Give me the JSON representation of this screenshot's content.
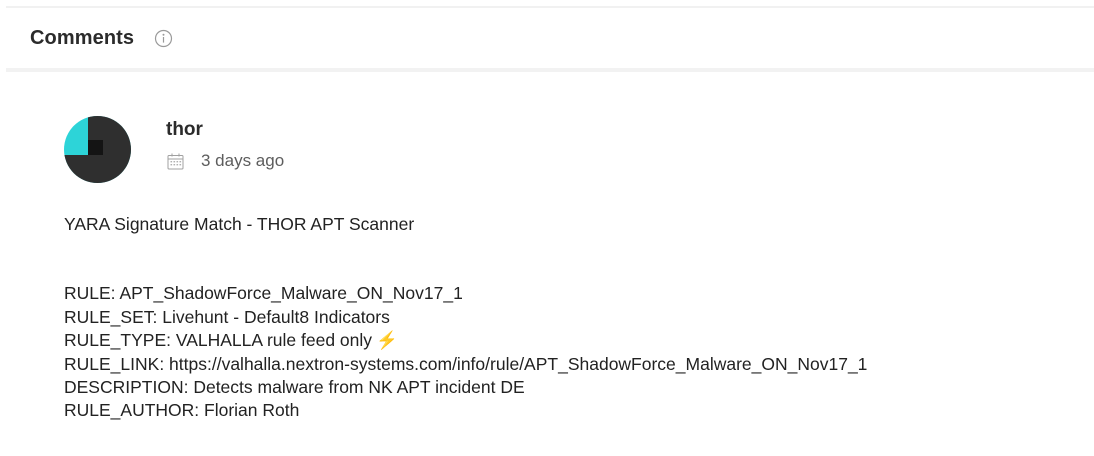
{
  "header": {
    "title": "Comments",
    "info_icon": "info-circle-icon"
  },
  "comment": {
    "author": "thor",
    "date": "3 days ago",
    "avatar_colors": {
      "accent": "#2dd4d8",
      "dark": "#2f2f2f"
    },
    "heading": "YARA Signature Match - THOR APT Scanner",
    "lines": [
      {
        "text": "RULE: APT_ShadowForce_Malware_ON_Nov17_1"
      },
      {
        "text": "RULE_SET: Livehunt - Default8 Indicators"
      },
      {
        "text": "RULE_TYPE: VALHALLA rule feed only",
        "suffix": "⚡"
      },
      {
        "text": "RULE_LINK: https://valhalla.nextron-systems.com/info/rule/APT_ShadowForce_Malware_ON_Nov17_1"
      },
      {
        "text": "DESCRIPTION: Detects malware from NK APT incident DE"
      },
      {
        "text": "RULE_AUTHOR: Florian Roth"
      }
    ]
  }
}
